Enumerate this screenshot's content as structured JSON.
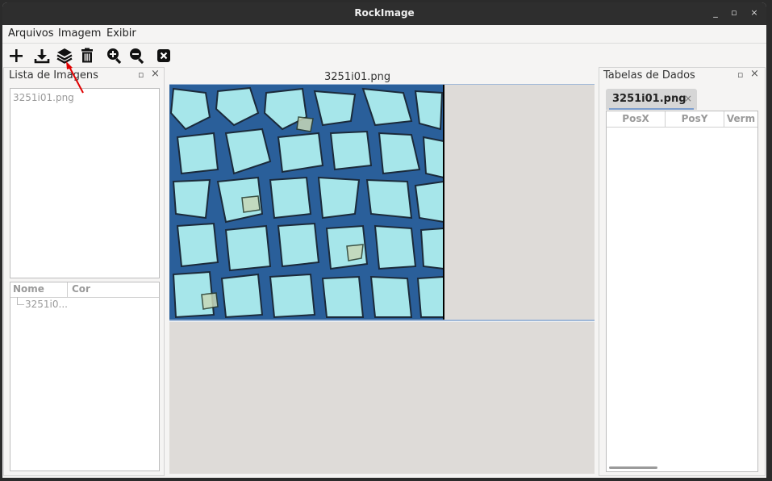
{
  "window": {
    "title": "RockImage",
    "minimize": "_",
    "maximize": "▫",
    "close": "×"
  },
  "menu": [
    "Arquivos",
    "Imagem",
    "Exibir"
  ],
  "toolbar_icons": [
    "add-icon",
    "download-icon",
    "layers-icon",
    "trash-icon",
    "zoom-in-icon",
    "zoom-out-icon",
    "close-image-icon"
  ],
  "left_panel": {
    "title": "Lista de Imagens",
    "images": [
      "3251i01.png"
    ],
    "tree_headers": [
      "Nome",
      "Cor"
    ],
    "tree_items": [
      "3251i0..."
    ]
  },
  "center": {
    "image_title": "3251i01.png"
  },
  "right_panel": {
    "title": "Tabelas de Dados",
    "tab_label": "3251i01.png",
    "tab_close": "×",
    "columns": [
      "PosX",
      "PosY",
      "Verm"
    ]
  },
  "panel_buttons": {
    "float": "▫",
    "close": "×"
  }
}
